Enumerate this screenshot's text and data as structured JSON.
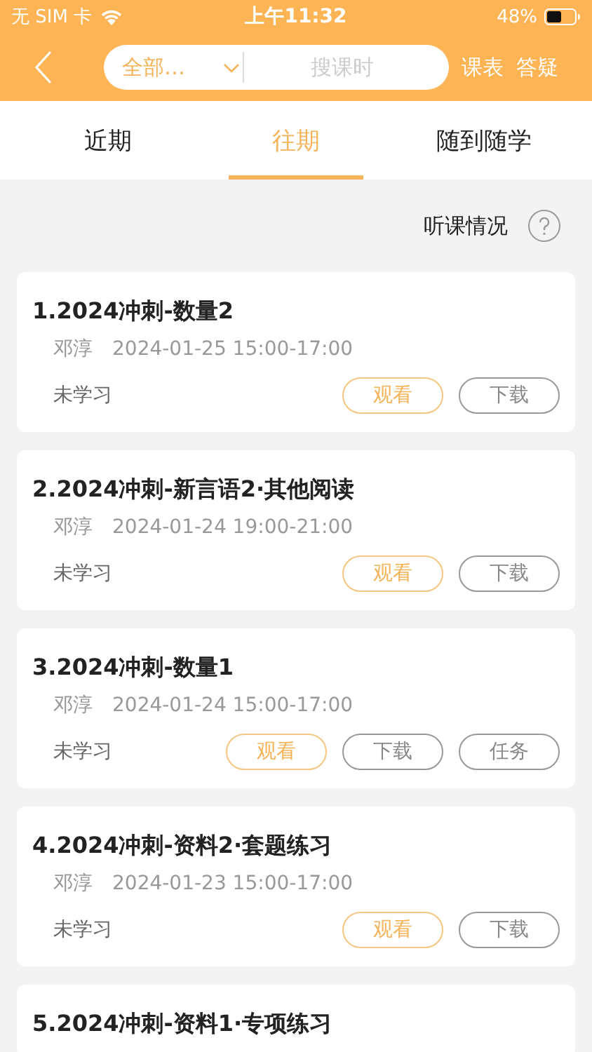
{
  "status_bar": {
    "carrier": "无 SIM 卡",
    "time": "上午11:32",
    "battery": "48%"
  },
  "nav": {
    "filter": "全部…",
    "search_placeholder": "搜课时",
    "actions": [
      "课表",
      "答疑"
    ]
  },
  "tabs": [
    {
      "label": "近期",
      "selected": false
    },
    {
      "label": "往期",
      "selected": true
    },
    {
      "label": "随到随学",
      "selected": false
    }
  ],
  "attendance_link": "听课情况",
  "lessons": [
    {
      "title": "1.2024冲刺-数量2",
      "teacher": "邓淳",
      "time": "2024-01-25 15:00-17:00",
      "status": "未学习",
      "buttons": [
        {
          "label": "观看",
          "kind": "primary"
        },
        {
          "label": "下载",
          "kind": "plain"
        }
      ]
    },
    {
      "title": "2.2024冲刺-新言语2·其他阅读",
      "teacher": "邓淳",
      "time": "2024-01-24 19:00-21:00",
      "status": "未学习",
      "buttons": [
        {
          "label": "观看",
          "kind": "primary"
        },
        {
          "label": "下载",
          "kind": "plain"
        }
      ]
    },
    {
      "title": "3.2024冲刺-数量1",
      "teacher": "邓淳",
      "time": "2024-01-24 15:00-17:00",
      "status": "未学习",
      "buttons": [
        {
          "label": "观看",
          "kind": "primary"
        },
        {
          "label": "下载",
          "kind": "plain"
        },
        {
          "label": "任务",
          "kind": "plain"
        }
      ]
    },
    {
      "title": "4.2024冲刺-资料2·套题练习",
      "teacher": "邓淳",
      "time": "2024-01-23 15:00-17:00",
      "status": "未学习",
      "buttons": [
        {
          "label": "观看",
          "kind": "primary"
        },
        {
          "label": "下载",
          "kind": "plain"
        }
      ]
    },
    {
      "title": "5.2024冲刺-资料1·专项练习"
    }
  ]
}
